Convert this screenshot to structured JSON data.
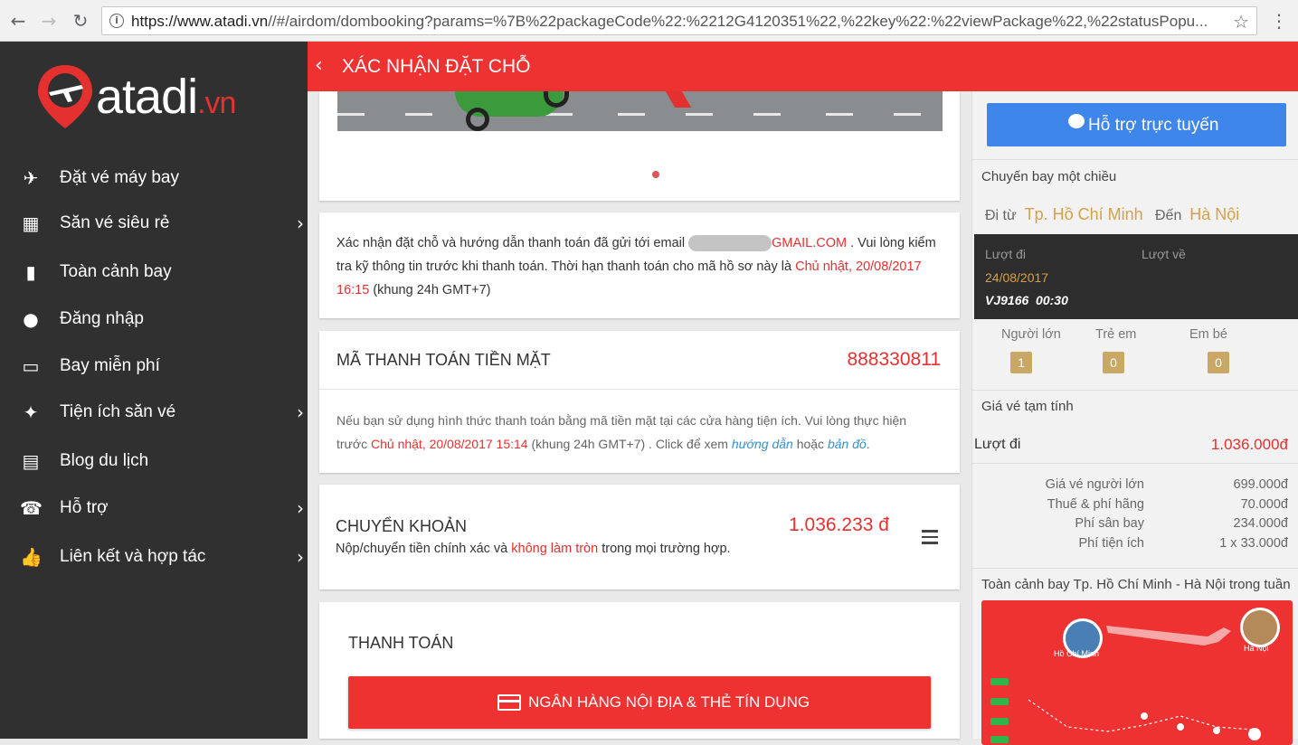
{
  "browser": {
    "url_host": "https://www.atadi.vn",
    "url_rest": "//#/airdom/dombooking?params=%7B%22packageCode%22:%2212G4120351%22,%22key%22:%22viewPackage%22,%22statusPopu..."
  },
  "sidebar": {
    "logo_main": "atadi",
    "logo_suffix": ".vn",
    "items": [
      {
        "label": "Đặt vé máy bay",
        "icon": "paper-plane-icon",
        "glyph": "✈",
        "has_arrow": false
      },
      {
        "label": "Săn vé siêu rẻ",
        "icon": "calendar-icon",
        "glyph": "▦",
        "has_arrow": true
      },
      {
        "label": "Toàn cảnh bay",
        "icon": "bar-chart-icon",
        "glyph": "▮",
        "has_arrow": false
      },
      {
        "label": "Đăng nhập",
        "icon": "user-icon",
        "glyph": "●",
        "has_arrow": false
      },
      {
        "label": "Bay miễn phí",
        "icon": "credit-card-icon",
        "glyph": "▭",
        "has_arrow": false
      },
      {
        "label": "Tiện ích săn vé",
        "icon": "magic-wand-icon",
        "glyph": "✦",
        "has_arrow": true
      },
      {
        "label": "Blog du lịch",
        "icon": "book-icon",
        "glyph": "▤",
        "has_arrow": false
      },
      {
        "label": "Hỗ trợ",
        "icon": "phone-icon",
        "glyph": "☎",
        "has_arrow": true
      },
      {
        "label": "Liên kết và hợp tác",
        "icon": "thumbs-up-icon",
        "glyph": "👍",
        "has_arrow": true
      }
    ]
  },
  "header": {
    "back_glyph": "‹",
    "title": "XÁC NHẬN ĐẶT CHỖ"
  },
  "confirm": {
    "line1_a": "Xác nhận đặt chỗ và hướng dẫn thanh toán đã gửi tới email ",
    "email_domain": "GMAIL.COM",
    "line1_b": " . Vui lòng kiểm",
    "line2_a": "tra kỹ thông tin trước khi thanh toán. Thời hạn thanh toán cho mã hồ sơ này là ",
    "deadline_a": "Chủ nhật, 20/08/2017",
    "deadline_b": "16:15",
    "line3_b": " (khung 24h GMT+7)"
  },
  "cash": {
    "title": "MÃ THANH TOÁN TIỀN MẶT",
    "code": "888330811",
    "text_a": "Nếu bạn sử dụng hình thức thanh toán bằng mã tiền mặt tại các cửa hàng tiện ích. Vui lòng thực hiện",
    "text_b": "trước ",
    "deadline": "Chủ nhật, 20/08/2017 15:14",
    "text_c": " (khung 24h GMT+7) . Click để xem ",
    "link_guide": "hướng dẫn",
    "text_d": " hoặc ",
    "link_map": "bản đồ",
    "text_e": "."
  },
  "transfer": {
    "title": "CHUYỂN KHOẢN",
    "amount": "1.036.233 đ",
    "note_a": "Nộp/chuyển tiền chính xác và ",
    "note_red": "không làm tròn",
    "note_b": " trong mọi trường hợp."
  },
  "payment": {
    "title": "THANH TOÁN",
    "bank_button": "NGÂN HÀNG NỘI ĐỊA & THẺ TÍN DỤNG"
  },
  "right": {
    "support_button": "Hỗ trợ trực tuyến",
    "trip_type": "Chuyến bay một chiều",
    "from_label": "Đi từ",
    "from_city": "Tp. Hồ Chí Minh",
    "to_label": "Đến",
    "to_city": "Hà Nội",
    "outbound_label": "Lượt đi",
    "return_label": "Lượt về",
    "outbound_date": "24/08/2017",
    "outbound_flight": "VJ9166  00:30",
    "pax": [
      {
        "label": "Người lớn",
        "count": "1"
      },
      {
        "label": "Trẻ em",
        "count": "0"
      },
      {
        "label": "Em bé",
        "count": "0"
      }
    ],
    "estimate_title": "Giá vé tạm tính",
    "outbound_total_label": "Lượt đi",
    "outbound_total": "1.036.000đ",
    "fares": [
      {
        "label": "Giá vé người lớn",
        "value": "699.000đ"
      },
      {
        "label": "Thuế & phí hãng",
        "value": "70.000đ"
      },
      {
        "label": "Phí sân bay",
        "value": "234.000đ"
      },
      {
        "label": "Phí tiện ích",
        "value": "1 x 33.000đ"
      }
    ],
    "weekly_title": "Toàn cảnh bay Tp. Hồ Chí Minh - Hà Nội trong tuần",
    "chart_city_left": "Hồ Chí Minh",
    "chart_city_right": "Hà Nội"
  },
  "colors": {
    "brand_red": "#ee3131",
    "sidebar_bg": "#303030",
    "support_blue": "#3f86ea",
    "gold": "#d6a049"
  }
}
